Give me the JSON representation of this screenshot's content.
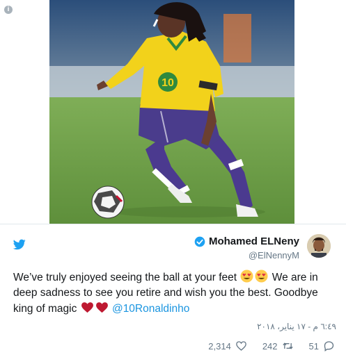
{
  "media": {
    "alt": "Footballer in yellow and blue kit dribbling a ball",
    "jersey_number": "10"
  },
  "author": {
    "display_name": "Mohamed ELNeny",
    "handle": "@ElNennyM",
    "verified": true
  },
  "tweet": {
    "text_part1": "We’ve truly enjoyed seeing the ball at your feet",
    "text_part2": " We are in deep sadness to see you retire and wish you the best. Goodbye king of magic ",
    "mention": "@10Ronaldinho",
    "timestamp": "٦:٤٩ م - ١٧ يناير، ٢٠١٨"
  },
  "actions": {
    "likes": "2,314",
    "retweets": "242",
    "replies": "51"
  },
  "icons": {
    "info": "info-icon",
    "brand": "twitter-bird-icon",
    "verified": "verified-badge-icon",
    "heart_eyes": "heart-eyes-emoji",
    "red_heart": "red-heart-emoji",
    "like": "heart-icon",
    "retweet": "retweet-icon",
    "reply": "reply-icon"
  },
  "colors": {
    "twitter_blue": "#1da1f2",
    "mention_blue": "#1b95e0",
    "muted_text": "#657786",
    "jersey_yellow": "#f2d21b",
    "shorts_purple": "#4a3c8c"
  }
}
